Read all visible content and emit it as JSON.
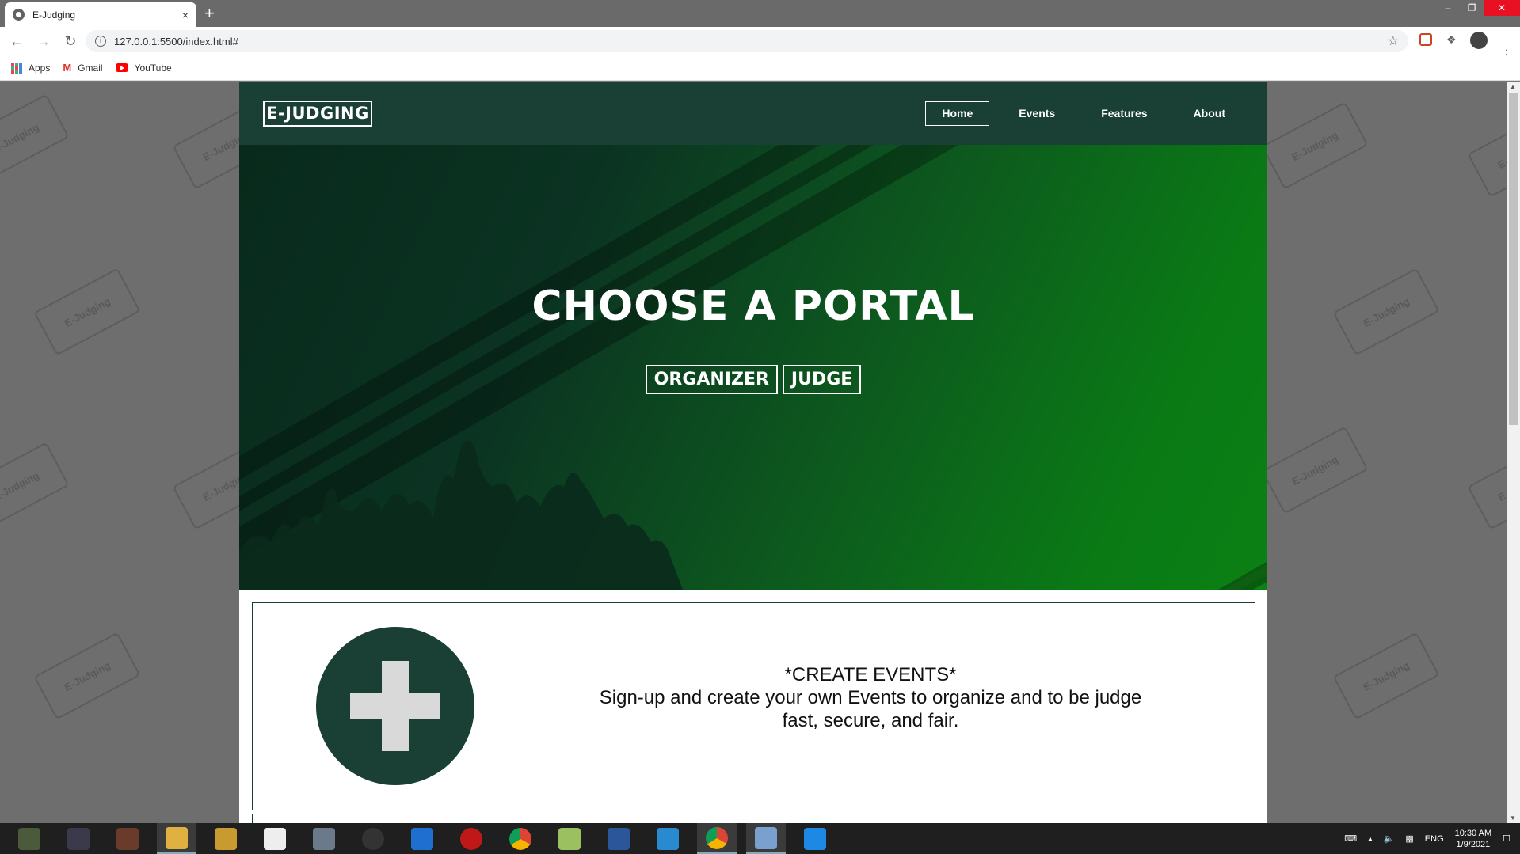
{
  "browser": {
    "tab_title": "E-Judging",
    "tab_close": "×",
    "new_tab": "+",
    "url": "127.0.0.1:5500/index.html#",
    "bookmarks": [
      {
        "label": "Apps",
        "icon": "apps-grid-icon"
      },
      {
        "label": "Gmail",
        "icon": "gmail-icon"
      },
      {
        "label": "YouTube",
        "icon": "youtube-icon"
      }
    ]
  },
  "site": {
    "logo": "E-JUDGING",
    "nav": [
      {
        "label": "Home",
        "active": true
      },
      {
        "label": "Events",
        "active": false
      },
      {
        "label": "Features",
        "active": false
      },
      {
        "label": "About",
        "active": false
      }
    ],
    "hero": {
      "title": "CHOOSE A PORTAL",
      "buttons": [
        "ORGANIZER",
        "JUDGE"
      ]
    },
    "feature_card": {
      "icon": "plus-circle-icon",
      "heading": "*CREATE EVENTS*",
      "line1": "Sign-up and create your own Events to organize and to be judge",
      "line2": "fast, secure, and fair."
    },
    "watermark": "E-Judging"
  },
  "taskbar": {
    "clock_time": "10:30 AM",
    "clock_date": "1/9/2021",
    "language": "ENG"
  },
  "colors": {
    "nav_bg": "#1a3f34",
    "accent_green": "#0b8014",
    "dark_green": "#082a1c"
  }
}
